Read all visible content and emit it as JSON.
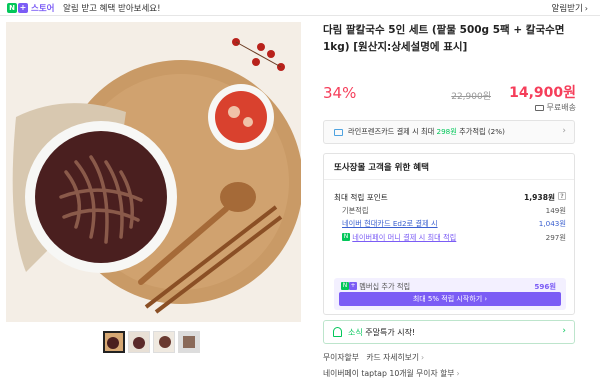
{
  "topbar": {
    "n_badge": "N",
    "plus_badge": "+",
    "store_label": "스토어",
    "promo_text": "알림 받고 혜택 받아보세요!",
    "alarm_label": "알림받기",
    "alarm_chevron": "›"
  },
  "product": {
    "title": "다림 팥칼국수 5인 세트 (팥물 500g 5팩 + 칼국수면 1kg) [원산지:상세설명에 표시]",
    "discount": "34%",
    "original_price": "22,900원",
    "price": "14,900원",
    "shipping": "무료배송"
  },
  "card_banner": {
    "text_prefix": "라인프렌즈카드 결제 시 최대 ",
    "text_highlight": "298원",
    "text_suffix": " 추가적립 (2%)",
    "arrow": "›"
  },
  "benefit": {
    "header": "또사장몰 고객을 위한 혜택",
    "max_points_label": "최대 적립 포인트",
    "max_points_value": "1,938원",
    "basic_label": "기본적립",
    "basic_value": "149원",
    "hyundai_label": "네이버 현대카드 Ed2로 결제 시",
    "hyundai_value": "1,043원",
    "money_label": "네이버페이 머니 결제 시 최대 적립",
    "money_value": "297원",
    "question_mark": "?",
    "membership_label": "멤버십 추가 적립",
    "membership_value": "596원",
    "membership_button": "최대 5% 적립 시작하기 ›"
  },
  "news": {
    "label_green": "소식",
    "label_text": " 주말특가 시작!",
    "arrow": "›"
  },
  "installment": {
    "line1_label": "무이자할부",
    "line1_detail": "카드 자세히보기",
    "line2": "네이버페이 taptap 10개월 무이자 할부",
    "chevron": "›"
  },
  "colors": {
    "accent": "#f53e5a",
    "naver_green": "#03c75a",
    "plus_purple": "#7b5cf5"
  }
}
